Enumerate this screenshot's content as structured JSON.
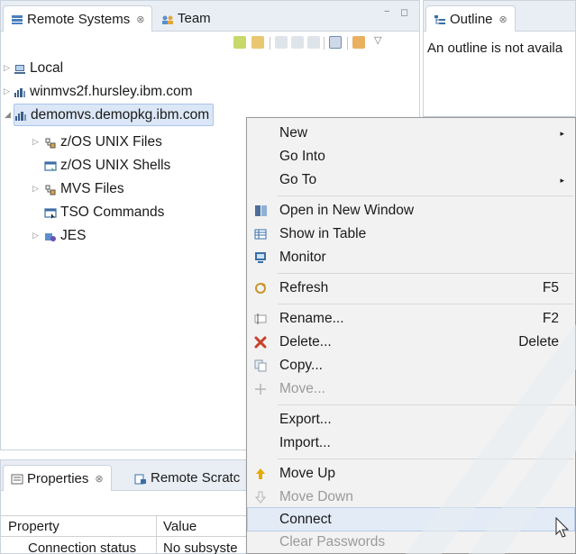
{
  "remote_systems": {
    "tab_label": "Remote Systems",
    "close_glyph": "⊗",
    "team_tab_label": "Team",
    "min_glyph": "−",
    "max_glyph": "◻",
    "view_menu_glyph": "▽",
    "tree": [
      {
        "label": "Local",
        "icon": "local-system-icon",
        "expanded": false
      },
      {
        "label": "winmvs2f.hursley.ibm.com",
        "icon": "remote-host-icon",
        "expanded": false
      },
      {
        "label": "demomvs.demopkg.ibm.com",
        "icon": "remote-host-icon",
        "expanded": true,
        "selected": true
      },
      {
        "label": "z/OS UNIX Files",
        "icon": "files-subsystem-icon",
        "expanded": false
      },
      {
        "label": "z/OS UNIX Shells",
        "icon": "shells-icon",
        "expanded": null
      },
      {
        "label": "MVS Files",
        "icon": "files-subsystem-icon",
        "expanded": false
      },
      {
        "label": "TSO Commands",
        "icon": "commands-icon",
        "expanded": null
      },
      {
        "label": "JES",
        "icon": "jes-icon",
        "expanded": false
      }
    ]
  },
  "properties": {
    "tab_label": "Properties",
    "close_glyph": "⊗",
    "scratch_tab_label": "Remote Scratc",
    "col_property": "Property",
    "col_value": "Value",
    "row_property": "Connection status",
    "row_value": "No subsyste"
  },
  "outline": {
    "tab_label": "Outline",
    "close_glyph": "⊗",
    "message": "An outline is not availa"
  },
  "context_menu": {
    "items": [
      {
        "label": "New",
        "submenu": true
      },
      {
        "label": "Go Into"
      },
      {
        "label": "Go To",
        "submenu": true
      },
      {
        "label": "Open in New Window",
        "icon": "open-window-icon"
      },
      {
        "label": "Show in Table",
        "icon": "table-icon"
      },
      {
        "label": "Monitor",
        "icon": "monitor-icon"
      },
      {
        "label": "Refresh",
        "shortcut": "F5",
        "icon": "refresh-icon"
      },
      {
        "label": "Rename...",
        "shortcut": "F2",
        "icon": "rename-icon"
      },
      {
        "label": "Delete...",
        "shortcut": "Delete",
        "icon": "delete-icon"
      },
      {
        "label": "Copy...",
        "icon": "copy-icon"
      },
      {
        "label": "Move...",
        "icon": "move-icon",
        "disabled": true
      },
      {
        "label": "Export..."
      },
      {
        "label": "Import..."
      },
      {
        "label": "Move Up",
        "icon": "move-up-icon"
      },
      {
        "label": "Move Down",
        "icon": "move-down-icon",
        "disabled": true
      },
      {
        "label": "Connect",
        "hover": true
      },
      {
        "label": "Clear Passwords",
        "disabled": true
      }
    ],
    "submenu_glyph": "▸",
    "expanded_glyph": "◢",
    "collapsed_glyph": "▷"
  },
  "colors": {
    "accent_blue": "#3b7bd4",
    "selection_bg": "#dbe7f6",
    "delete_red": "#c8402a",
    "move_up_yellow": "#e5a900"
  }
}
